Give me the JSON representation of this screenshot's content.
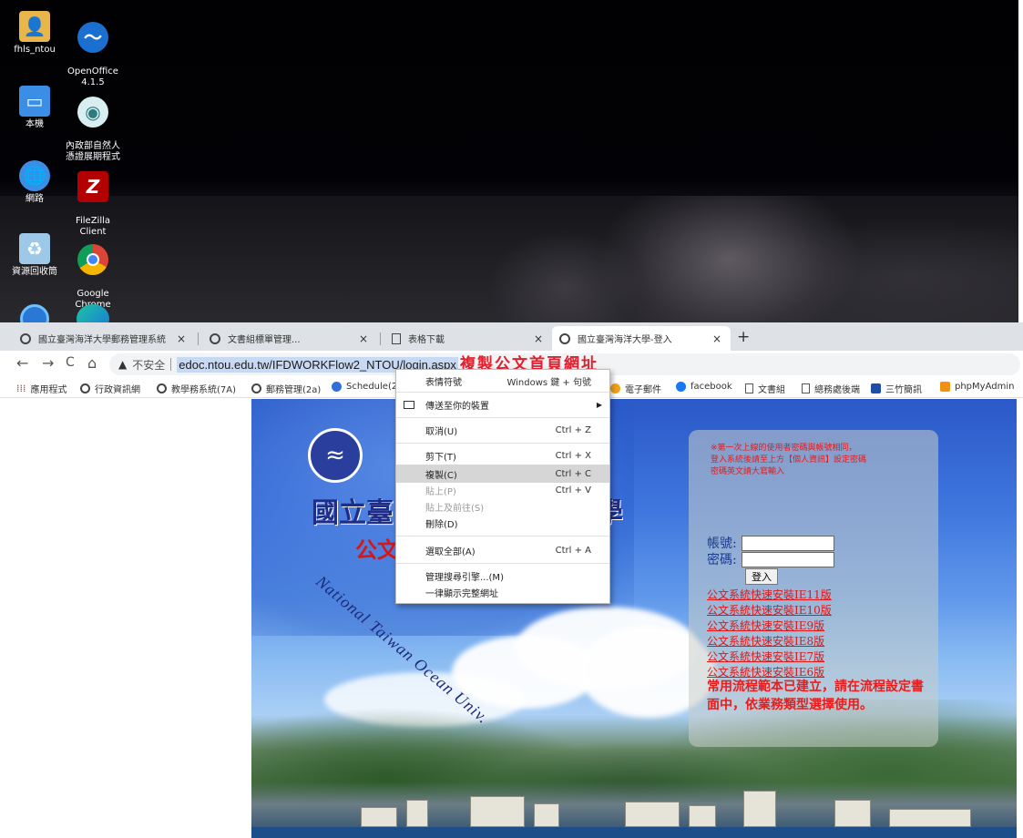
{
  "desktop": {
    "icons": [
      {
        "id": "fhls",
        "label": "fhls_ntou",
        "icon": "user-folder-icon"
      },
      {
        "id": "openoffice",
        "label": "OpenOffice\n4.1.5",
        "icon": "openoffice-icon"
      },
      {
        "id": "thispc",
        "label": "本機",
        "icon": "computer-icon"
      },
      {
        "id": "moica",
        "label": "內政部自然人\n憑證展期程式",
        "icon": "moica-seal-icon"
      },
      {
        "id": "network",
        "label": "網路",
        "icon": "network-icon"
      },
      {
        "id": "filezilla",
        "label": "FileZilla\nClient",
        "icon": "filezilla-icon"
      },
      {
        "id": "recycle",
        "label": "資源回收筒",
        "icon": "recycle-bin-icon"
      },
      {
        "id": "chrome",
        "label": "Google\nChrome",
        "icon": "chrome-icon"
      }
    ]
  },
  "browser": {
    "tabs": [
      {
        "title": "國立臺灣海洋大學郵務管理系統",
        "icon": "globe-icon"
      },
      {
        "title": "文書組標單管理...",
        "icon": "globe-icon"
      },
      {
        "title": "表格下載",
        "icon": "document-icon"
      },
      {
        "title": "國立臺灣海洋大學-登入",
        "icon": "globe-icon",
        "active": true
      }
    ],
    "new_tab": "+",
    "close": "×",
    "nav": {
      "back": "←",
      "forward": "→",
      "reload": "C",
      "home": "⌂"
    },
    "omnibox": {
      "warning_icon": "▲",
      "security_label": "不安全",
      "url": "edoc.ntou.edu.tw/IFDWORKFlow2_NTOU/login.aspx"
    },
    "annotation": "複製公文首頁網址",
    "bookmarks": [
      {
        "label": "應用程式",
        "icon": "apps-grid-icon"
      },
      {
        "label": "行政資訊網",
        "icon": "globe-icon"
      },
      {
        "label": "教學務系統(7A)",
        "icon": "globe-icon"
      },
      {
        "label": "郵務管理(2a)",
        "icon": "globe-icon"
      },
      {
        "label": "Schedule(2",
        "icon": "schedule-icon"
      },
      {
        "label": "電子郵件",
        "icon": "mail-icon"
      },
      {
        "label": "facebook",
        "icon": "facebook-icon"
      },
      {
        "label": "文書組",
        "icon": "document-icon"
      },
      {
        "label": "總務處後端",
        "icon": "document-icon"
      },
      {
        "label": "三竹簡訊",
        "icon": "mitake-icon"
      },
      {
        "label": "phpMyAdmin",
        "icon": "phpmyadmin-icon"
      }
    ]
  },
  "context_menu": {
    "items": [
      {
        "label": "表情符號",
        "shortcut": "Windows 鍵 + 句號",
        "disabled": false
      },
      {
        "label": "傳送至你的裝置",
        "shortcut": "",
        "submenu": true,
        "icon": "cast-device-icon"
      },
      {
        "label": "取消(U)",
        "shortcut": "Ctrl + Z",
        "disabled": false
      },
      {
        "label": "剪下(T)",
        "shortcut": "Ctrl + X",
        "disabled": false
      },
      {
        "label": "複製(C)",
        "shortcut": "Ctrl + C",
        "highlighted": true
      },
      {
        "label": "貼上(P)",
        "shortcut": "Ctrl + V",
        "disabled": true
      },
      {
        "label": "貼上及前往(S)",
        "shortcut": "",
        "disabled": true
      },
      {
        "label": "刪除(D)",
        "shortcut": "",
        "disabled": false
      },
      {
        "label": "選取全部(A)",
        "shortcut": "Ctrl + A",
        "disabled": false
      },
      {
        "label": "管理搜尋引擎...(M)",
        "shortcut": "",
        "disabled": false
      },
      {
        "label": "一律顯示完整網址",
        "shortcut": "",
        "disabled": false
      }
    ]
  },
  "page": {
    "title_left": "國立臺",
    "title_right": "學",
    "subtitle": "公文",
    "english_name": "National Taiwan Ocean Univ.",
    "login": {
      "notice": [
        "※第一次上線的使用者密碼與帳號相同，",
        "登入系統後請至上方【個人資訊】設定密碼",
        "密碼英文請大寫輸入"
      ],
      "account_label": "帳號:",
      "password_label": "密碼:",
      "account_value": "",
      "password_value": "",
      "login_button": "登入",
      "links": [
        "公文系統快速安裝IE11版",
        "公文系統快速安裝IE10版",
        "公文系統快速安裝IE9版",
        "公文系統快速安裝IE8版",
        "公文系統快速安裝IE7版",
        "公文系統快速安裝IE6版"
      ],
      "flow_note": "常用流程範本已建立，請在流程設定書面中，依業務類型選擇使用。"
    }
  }
}
